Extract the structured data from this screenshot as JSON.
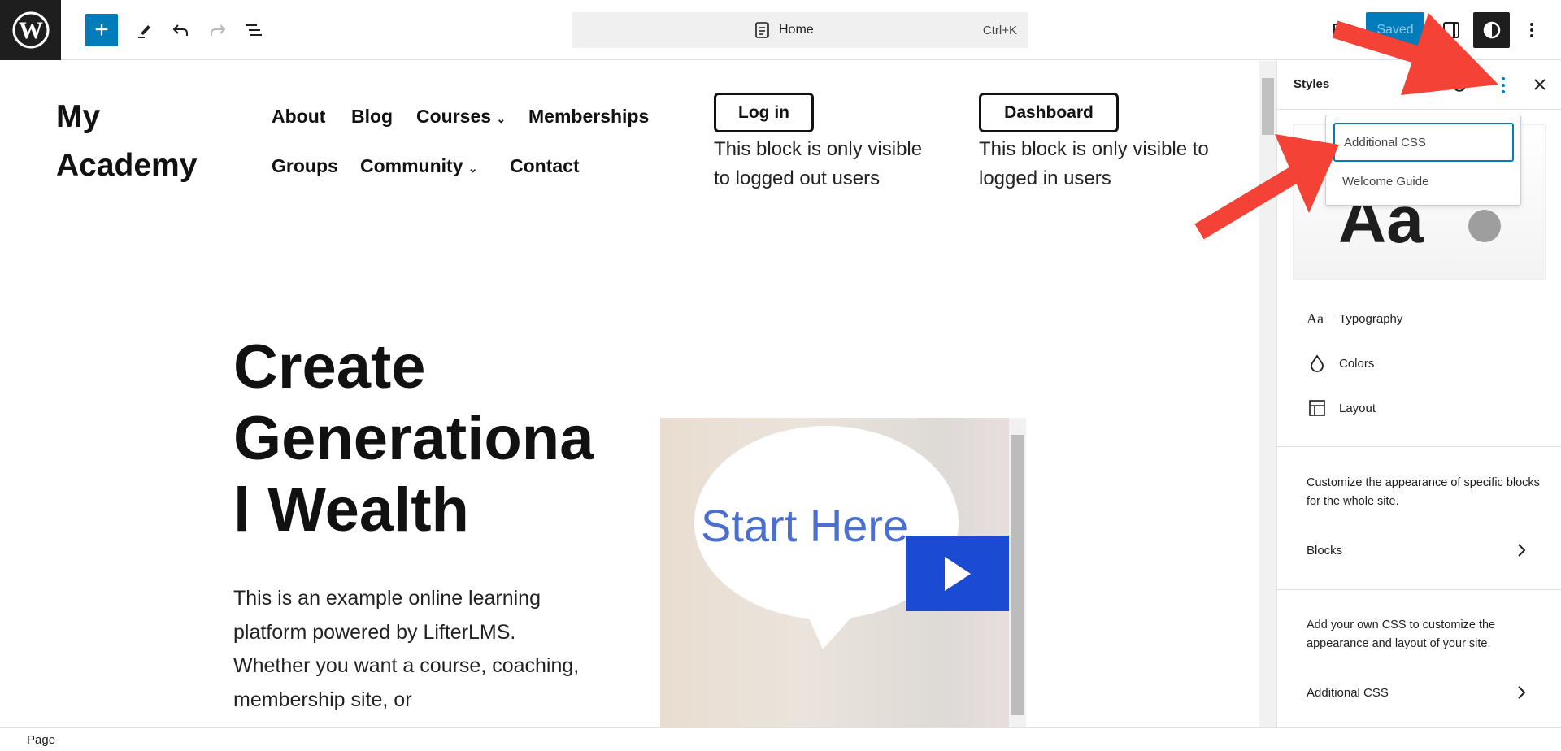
{
  "toolbar": {
    "add_label": "+",
    "command_bar": {
      "title": "Home",
      "shortcut": "Ctrl+K"
    },
    "saved_label": "Saved"
  },
  "site": {
    "brand_line1": "My",
    "brand_line2": "Academy",
    "nav": [
      "About",
      "Blog",
      "Courses",
      "Memberships",
      "Groups",
      "Community",
      "Contact"
    ],
    "login": {
      "label": "Log in",
      "note": "This block is only visible to logged out users"
    },
    "dashboard": {
      "label": "Dashboard",
      "note": "This block is only visible to logged in users"
    },
    "hero_title": "Create Generational Wealth",
    "hero_text": "This is an example online learning platform powered by LifterLMS. Whether you want a course, coaching, membership site, or",
    "video": {
      "title": "Start Here"
    }
  },
  "sidebar": {
    "title": "Styles",
    "preview_text": "Aa",
    "items": [
      {
        "label": "Typography",
        "icon": "typography-icon"
      },
      {
        "label": "Colors",
        "icon": "droplet-icon"
      },
      {
        "label": "Layout",
        "icon": "layout-icon"
      }
    ],
    "blocks_desc": "Customize the appearance of specific blocks for the whole site.",
    "blocks_label": "Blocks",
    "css_desc": "Add your own CSS to customize the appearance and layout of your site.",
    "css_label": "Additional CSS",
    "menu": [
      "Additional CSS",
      "Welcome Guide"
    ]
  },
  "status": {
    "breadcrumb": "Page"
  },
  "colors": {
    "accent": "#007cba",
    "annotation": "#f44336",
    "play": "#1a4bd2"
  }
}
